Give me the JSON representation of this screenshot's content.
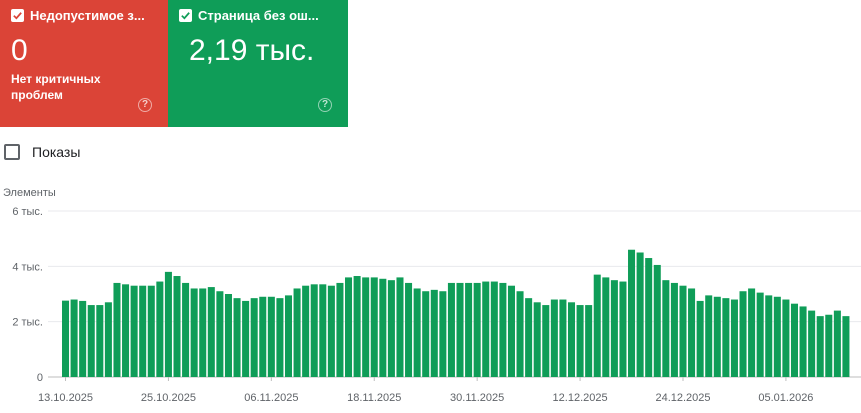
{
  "cards": [
    {
      "title": "Недопустимое з...",
      "value": "0",
      "description": "Нет критичных проблем",
      "color": "#db4437",
      "help_icon": "help-circle-icon",
      "checked": true
    },
    {
      "title": "Страница без ош...",
      "value": "2,19 тыс.",
      "description": "",
      "color": "#0f9d58",
      "help_icon": "help-circle-icon",
      "checked": true
    }
  ],
  "impressions": {
    "label": "Показы",
    "checked": false
  },
  "chart_data": {
    "type": "bar",
    "ylabel": "Элементы",
    "ylim": [
      0,
      6000
    ],
    "y_ticks": [
      {
        "value": 0,
        "label": "0"
      },
      {
        "value": 2000,
        "label": "2 тыс."
      },
      {
        "value": 4000,
        "label": "4 тыс."
      },
      {
        "value": 6000,
        "label": "6 тыс."
      }
    ],
    "x_tick_labels": [
      "13.10.2025",
      "25.10.2025",
      "06.11.2025",
      "18.11.2025",
      "30.11.2025",
      "12.12.2025",
      "24.12.2025",
      "05.01.2026"
    ],
    "color": "#0f9d58",
    "series": [
      {
        "values": [
          2760,
          2800,
          2750,
          2600,
          2600,
          2700,
          3400,
          3350,
          3300,
          3300,
          3300,
          3450,
          3800,
          3650,
          3400,
          3200,
          3200,
          3250,
          3100,
          3000,
          2850,
          2750,
          2850,
          2900,
          2900,
          2850,
          2950,
          3200,
          3300,
          3350,
          3350,
          3300,
          3400,
          3600,
          3650,
          3600,
          3600,
          3550,
          3500,
          3600,
          3400,
          3200,
          3100,
          3150,
          3100,
          3400,
          3400,
          3400,
          3400,
          3450,
          3450,
          3400,
          3300,
          3100,
          2850,
          2700,
          2600,
          2800,
          2800,
          2700,
          2600,
          2600,
          3700,
          3600,
          3500,
          3450,
          4600,
          4500,
          4300,
          4050,
          3500,
          3400,
          3300,
          3200,
          2750,
          2950,
          2900,
          2850,
          2800,
          3100,
          3200,
          3050,
          2950,
          2900,
          2800,
          2650,
          2550,
          2400,
          2200,
          2250,
          2400,
          2200
        ]
      }
    ]
  }
}
